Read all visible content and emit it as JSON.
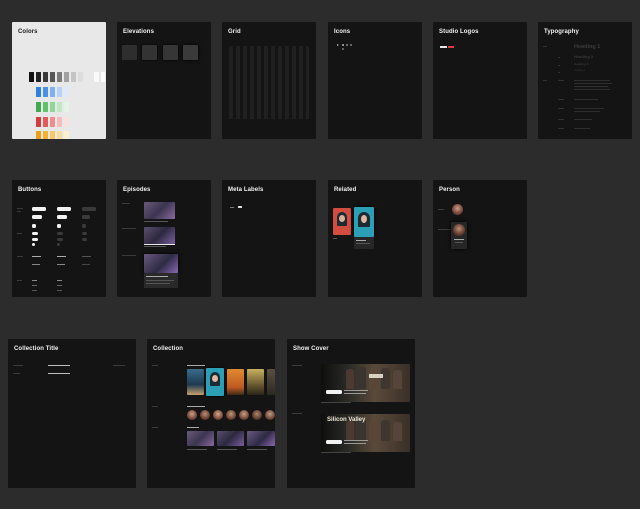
{
  "frames": {
    "colors": "Colors",
    "elevations": "Elevations",
    "grid": "Grid",
    "icons": "Icons",
    "studio_logos": "Studio Logos",
    "typography": "Typography",
    "buttons": "Buttons",
    "episodes": "Episodes",
    "meta_labels": "Meta Labels",
    "related": "Related",
    "person": "Person",
    "collection_title": "Collection Title",
    "collection": "Collection",
    "show_cover": "Show Cover"
  },
  "typography_samples": {
    "h1": "Heading 1",
    "h2": "Heading 2",
    "h3": "Heading 3",
    "h4": "Heading 4"
  },
  "show_cover": {
    "second_title": "Silicon Valley"
  },
  "palette": {
    "background": "#2c2c2c",
    "frame": "#141414",
    "light_frame": "#e8e8e8",
    "blue": "#4a90e2",
    "green": "#5ec26a",
    "red": "#e05a5a",
    "yellow": "#f2b230",
    "brand_red": "#e03a3a"
  }
}
